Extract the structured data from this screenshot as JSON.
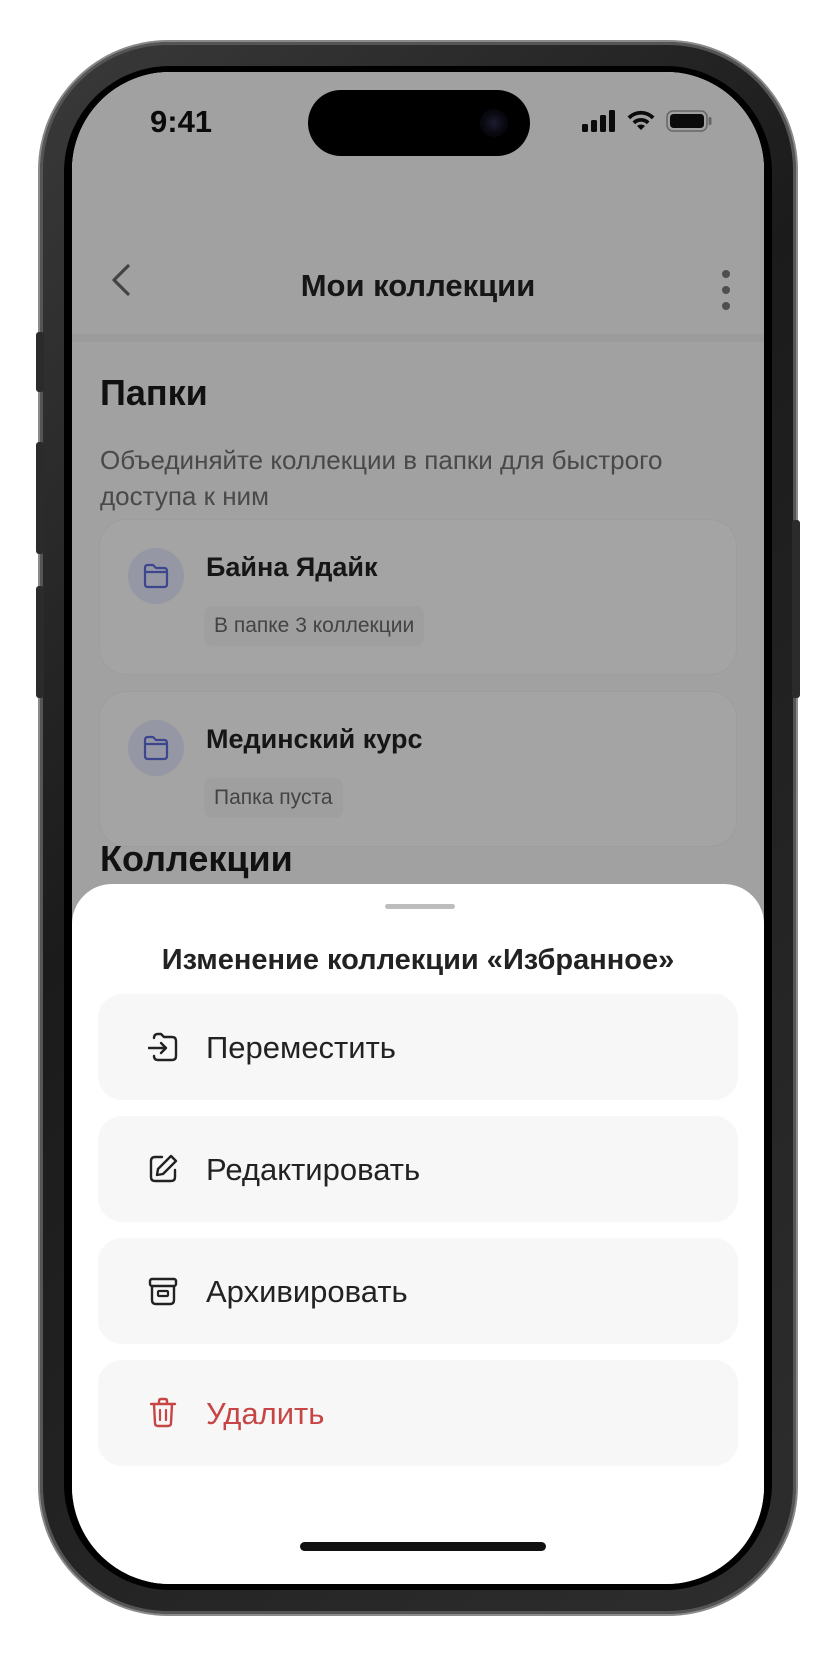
{
  "status_bar": {
    "time": "9:41"
  },
  "nav": {
    "back_icon": "chevron-left-icon",
    "title": "Мои коллекции",
    "more_icon": "more-vertical-icon"
  },
  "folders_section": {
    "title": "Папки",
    "description": "Объединяйте коллекции в папки для быстрого доступа к ним",
    "items": [
      {
        "name": "Байна Ядайк",
        "meta": "В папке 3 коллекции",
        "icon": "folder-icon"
      },
      {
        "name": "Мединский курс",
        "meta": "Папка пуста",
        "icon": "folder-icon"
      }
    ]
  },
  "collections_section": {
    "title": "Коллекции"
  },
  "sheet": {
    "title": "Изменение коллекции «Избранное»",
    "actions": [
      {
        "label": "Переместить",
        "icon": "move-to-folder-icon"
      },
      {
        "label": "Редактировать",
        "icon": "edit-icon"
      },
      {
        "label": "Архивировать",
        "icon": "archive-icon"
      },
      {
        "label": "Удалить",
        "icon": "trash-icon",
        "color": "#c74545"
      }
    ]
  },
  "colors": {
    "accent_folder": "#e3e6fb",
    "danger": "#c74545",
    "sheet_bg": "#ffffff",
    "action_bg": "#f7f7f7"
  }
}
